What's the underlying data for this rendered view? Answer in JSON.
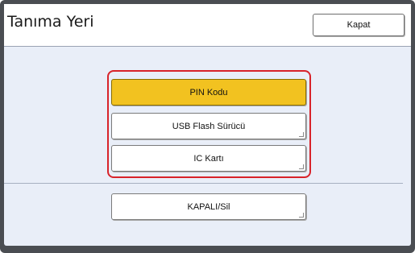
{
  "header": {
    "title": "Tanıma Yeri",
    "close_label": "Kapat"
  },
  "options": [
    {
      "label": "PIN Kodu",
      "selected": true
    },
    {
      "label": "USB Flash Sürücü",
      "selected": false
    },
    {
      "label": "IC Kartı",
      "selected": false
    }
  ],
  "off_label": "KAPALI/Sil",
  "colors": {
    "selected": "#f2c220",
    "highlight_border": "#d8232a",
    "panel_bg": "#e9eef8",
    "frame": "#4a4d52"
  }
}
